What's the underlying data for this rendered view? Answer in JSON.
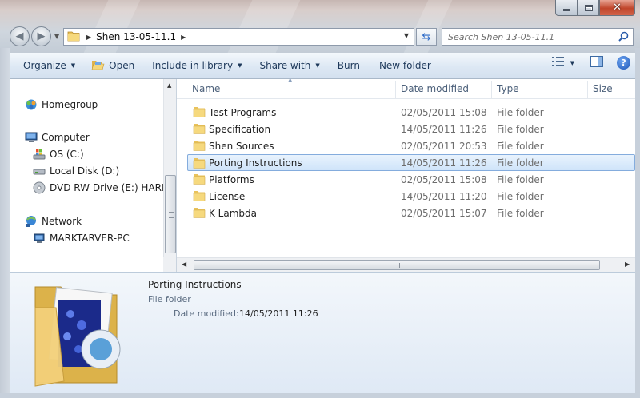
{
  "window": {
    "caption_minimize": "minimize",
    "caption_maximize": "maximize",
    "caption_close": "close"
  },
  "address": {
    "crumb": "Shen 13-05-11.1"
  },
  "search": {
    "placeholder": "Search Shen 13-05-11.1"
  },
  "toolbar": {
    "organize": "Organize",
    "open": "Open",
    "include_in_library": "Include in library",
    "share_with": "Share with",
    "burn": "Burn",
    "new_folder": "New folder",
    "help": "?"
  },
  "navpane": {
    "homegroup": "Homegroup",
    "computer": "Computer",
    "drive_c": "OS (C:)",
    "drive_d": "Local Disk (D:)",
    "drive_e": "DVD RW Drive (E:) HARRY_",
    "network": "Network",
    "network_pc": "MARKTARVER-PC"
  },
  "columns": {
    "name": "Name",
    "date_modified": "Date modified",
    "type": "Type",
    "size": "Size"
  },
  "files": [
    {
      "name": "Test Programs",
      "date": "02/05/2011 15:08",
      "type": "File folder"
    },
    {
      "name": "Specification",
      "date": "14/05/2011 11:26",
      "type": "File folder"
    },
    {
      "name": "Shen Sources",
      "date": "02/05/2011 20:53",
      "type": "File folder"
    },
    {
      "name": "Porting Instructions",
      "date": "14/05/2011 11:26",
      "type": "File folder"
    },
    {
      "name": "Platforms",
      "date": "02/05/2011 15:08",
      "type": "File folder"
    },
    {
      "name": "License",
      "date": "14/05/2011 11:20",
      "type": "File folder"
    },
    {
      "name": "K Lambda",
      "date": "02/05/2011 15:07",
      "type": "File folder"
    }
  ],
  "selected_index": 3,
  "details": {
    "name": "Porting Instructions",
    "type": "File folder",
    "date_label": "Date modified:",
    "date_value": "14/05/2011 11:26"
  },
  "colors": {
    "selection": "#cfe4fa",
    "selection_border": "#84acdd",
    "command_text": "#1e395b",
    "folder_yellow": "#f3d27a"
  }
}
